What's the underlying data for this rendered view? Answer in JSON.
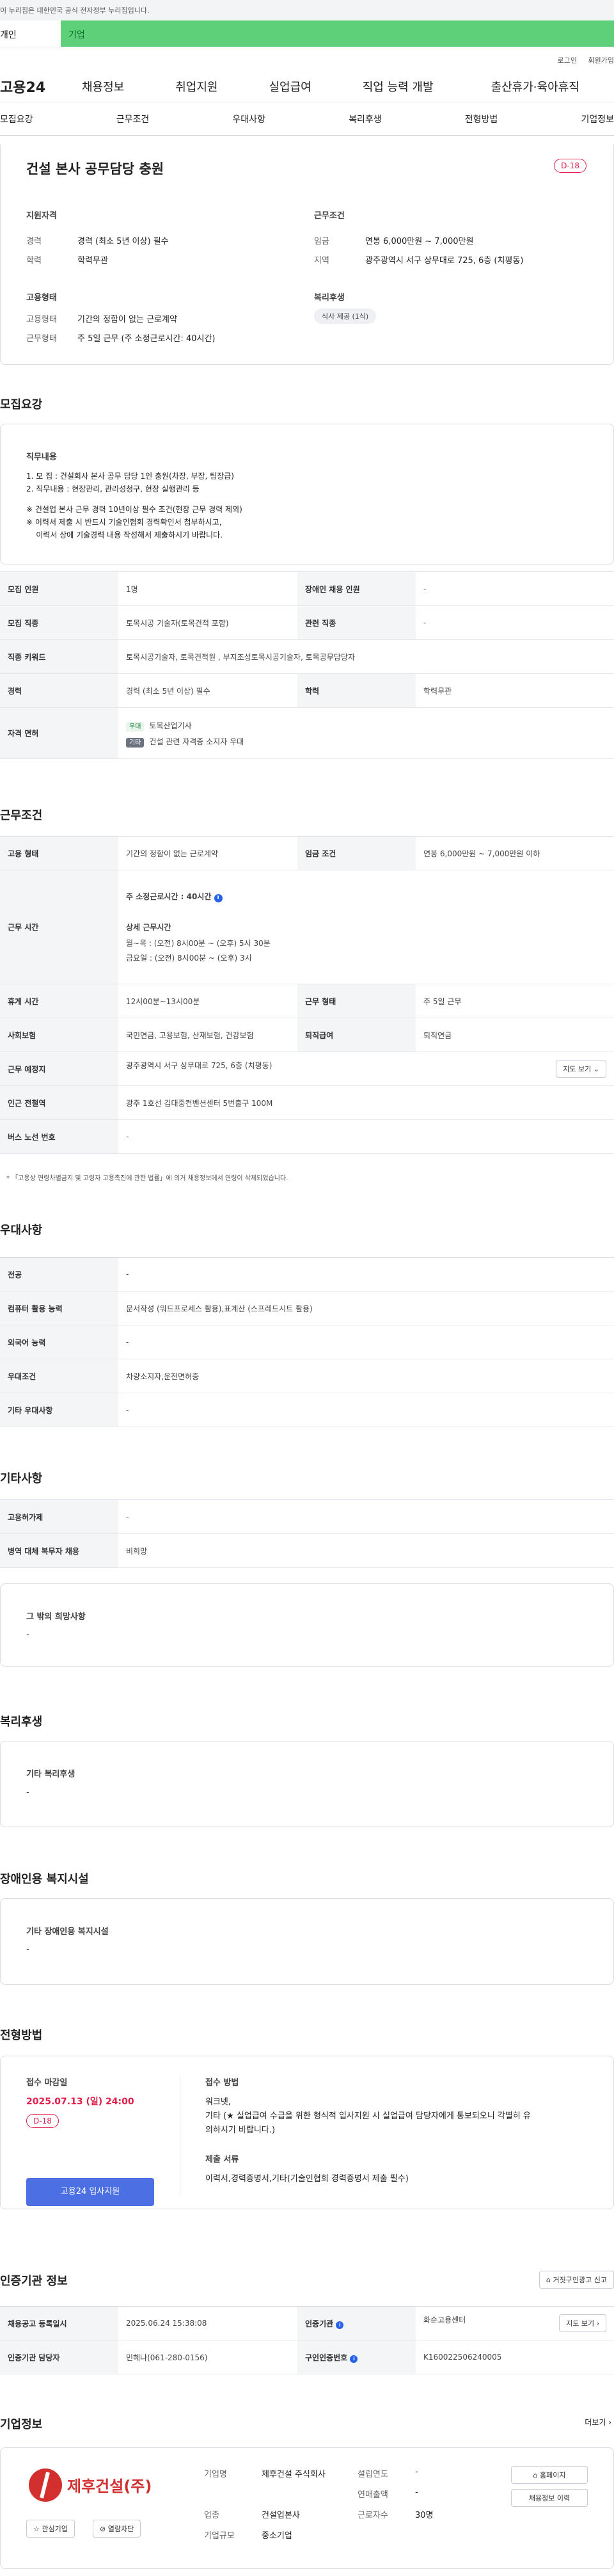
{
  "gov_banner": "이 누리집은 대한민국 공식 전자정부 누리집입니다.",
  "tabs": {
    "a": "개인",
    "b": "기업"
  },
  "util": [
    "로그인",
    "회원가입"
  ],
  "logo": "고용24",
  "gnb": [
    "채용정보",
    "취업지원",
    "실업급여",
    "직업 능력 개발",
    "출산휴가·육아휴직"
  ],
  "subnav": [
    "모집요강",
    "근무조건",
    "우대사항",
    "복리후생",
    "전형방법",
    "기업정보"
  ],
  "header": {
    "title": "건설 본사 공무담당 충원",
    "dday": "D-18",
    "qual_title": "지원자격",
    "career_label": "경력",
    "career": "경력 (최소 5년 이상) 필수",
    "edu_label": "학력",
    "edu": "학력무관",
    "cond_title": "근무조건",
    "wage_label": "임금",
    "wage": "연봉 6,000만원 ~ 7,000만원",
    "region_label": "지역",
    "region": "광주광역시 서구 상무대로 725, 6층 (치평동)",
    "emp_title": "고용형태",
    "emp_type_label": "고용형태",
    "emp_type": "기간의 정함이 없는 근로계약",
    "work_type_label": "근무형태",
    "work_type": "주 5일 근무 (주 소정근로시간: 40시간)",
    "welfare_title": "복리후생",
    "welfare_pill": "식사 제공 (1식)"
  },
  "recruit": {
    "title": "모집요강",
    "duty_title": "직무내용",
    "lines": [
      "1. 모       집 : 건설회사 본사 공무 담당 1인 충원(차장, 부장, 팀장급)",
      "2. 직무내용 : 현장관리, 관리성청구, 현장 실행관리 등",
      "※ 건설업 본사 근무 경력 10년이상 필수 조건(현장 근무 경력 제외)",
      "※ 이력서 제출 시 반드시 기술인협회 경력확인서 첨부하시고,",
      "    이력서 상에 기술경력 내용 작성해서 제출하시기 바랍니다."
    ],
    "rows": [
      [
        "모집 인원",
        "1명",
        "장애인 채용 인원",
        "-"
      ],
      [
        "모집 직종",
        "토목시공 기술자(토목견적 포함)",
        "관련 직종",
        "-"
      ]
    ],
    "keyword_label": "직종 키워드",
    "keyword": "토목시공기술자, 토목견적원 , 부지조성토목시공기술자, 토목공무담당자",
    "career_label": "경력",
    "career": "경력 (최소 5년 이상) 필수",
    "edu_label": "학력",
    "edu": "학력무관",
    "license_label": "자격 면허",
    "lic1_tag": "우대",
    "lic1": "토목산업기사",
    "lic2_tag": "기타",
    "lic2": "건설 관련 자격증 소지자 우대"
  },
  "work": {
    "title": "근무조건",
    "emp_label": "고용 형태",
    "emp": "기간의 정함이 없는 근로계약",
    "wage_label": "임금 조건",
    "wage": "연봉 6,000만원 ~ 7,000만원 이하",
    "time_label": "근무 시간",
    "time_main": "주 소정근로시간 : 40시간",
    "time_detail_title": "상세 근무시간",
    "time_d1": "월~목 : (오전) 8시00분 ~ (오후) 5시 30분",
    "time_d2": "금요일 : (오전) 8시00분 ~ (오후) 3시",
    "rest_label": "휴게 시간",
    "rest": "12시00분~13시00분",
    "form_label": "근무 형태",
    "form": "주 5일 근무",
    "ins_label": "사회보험",
    "ins": "국민연금, 고용보험, 산재보험, 건강보험",
    "ret_label": "퇴직급여",
    "ret": "퇴직연금",
    "place_label": "근무 예정지",
    "place": "광주광역시 서구 상무대로 725, 6층 (치평동)",
    "map_btn": "지도 보기",
    "subway_label": "인근 전철역",
    "subway": "광주 1호선 김대중컨벤션센터 5번출구 100M",
    "bus_label": "버스 노선 번호",
    "bus": "-",
    "note": "「고용상 연령차별금지 및 고령자 고용촉진에 관한 법률」에 의거 채용정보에서 연령이 삭제되었습니다."
  },
  "pref": {
    "title": "우대사항",
    "rows": [
      [
        "전공",
        "-"
      ],
      [
        "컴퓨터 활용 능력",
        "문서작성 (워드프로세스 활용),표계산 (스프레드시트 활용)"
      ],
      [
        "외국어 능력",
        "-"
      ],
      [
        "우대조건",
        "차량소지자,운전면허증"
      ],
      [
        "기타 우대사항",
        "-"
      ]
    ]
  },
  "etc": {
    "title": "기타사항",
    "rows": [
      [
        "고용허가제",
        "-"
      ],
      [
        "병역 대체 복무자 채용",
        "비희망"
      ]
    ],
    "wish_title": "그 밖의 희망사항",
    "wish": "-"
  },
  "welfare": {
    "title": "복리후생",
    "box_title": "기타 복리후생",
    "box": "-"
  },
  "disab": {
    "title": "장애인용 복지시설",
    "box_title": "기타 장애인용 복지시설",
    "box": "-"
  },
  "process": {
    "title": "전형방법",
    "deadline_title": "접수 마감일",
    "deadline": "2025.07.13 (일) 24:00",
    "dday": "D-18",
    "apply_btn": "고용24 입사지원",
    "method_title": "접수 방법",
    "method1": "워크넷,",
    "method2": "기타 (★ 실업급여 수급을 위한 형식적 입사지원 시 실업급여 담당자에게 통보되오니 각별히 유",
    "method3": "의하시기 바랍니다.)",
    "docs_title": "제출 서류",
    "docs": "이력서,경력증명서,기타(기술인협회 경력증명서 제출 필수)"
  },
  "agency": {
    "title": "인증기관 정보",
    "report_btn": "거짓구인광고 신고",
    "reg_label": "채용공고 등록일시",
    "reg": "2025.06.24 15:38:08",
    "org_label": "인증기관",
    "org": "화순고용센터",
    "map_btn": "지도 보기",
    "mgr_label": "인증기관 담당자",
    "mgr": "민혜나(061-280-0156)",
    "id_label": "구인인증번호",
    "id": "K160022506240005"
  },
  "company": {
    "title": "기업정보",
    "more": "더보기",
    "logo_text": "제후건설(주)",
    "fav_btn": "관심기업",
    "block_btn": "열람차단",
    "name_label": "기업명",
    "name": "제후건설 주식회사",
    "ind_label": "업종",
    "ind": "건설업본사",
    "size_label": "기업규모",
    "size": "중소기업",
    "est_label": "설립연도",
    "est": "-",
    "sales_label": "연매출액",
    "sales": "-",
    "emp_label": "근로자수",
    "emp": "30명",
    "home_btn": "홈페이지",
    "hist_btn": "채용정보 이력"
  }
}
